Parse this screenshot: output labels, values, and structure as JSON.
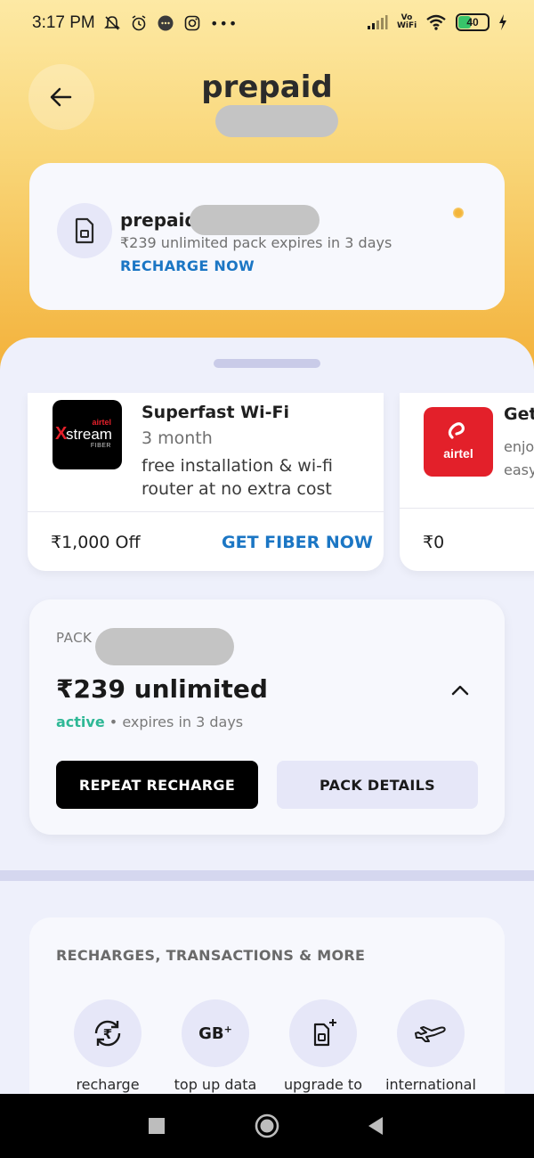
{
  "status_bar": {
    "time": "3:17 PM",
    "battery": "40",
    "vowifi": "Vo WiFi",
    "more": "•••"
  },
  "header": {
    "title": "prepaid"
  },
  "number_card": {
    "name": "prepaid",
    "subtitle": "₹239 unlimited pack expires in 3 days",
    "action": "RECHARGE NOW"
  },
  "offers": [
    {
      "logo_top": "airtel",
      "logo_main": "stream",
      "logo_bottom": "FIBER",
      "title": "Superfast Wi-Fi",
      "duration": "3 month",
      "description_line1": "free installation & wi-fi",
      "description_line2": "router at no extra cost",
      "price": "₹1,000 Off",
      "cta": "GET FIBER NOW"
    },
    {
      "logo_text": "airtel",
      "title": "Get",
      "description_line1": "enjo",
      "description_line2": "easy",
      "price": "₹0"
    }
  ],
  "pack": {
    "label": "PACK",
    "name": "₹239 unlimited",
    "status_active": "active",
    "status_rest": " • expires in 3 days",
    "repeat_label": "REPEAT RECHARGE",
    "details_label": "PACK DETAILS"
  },
  "more": {
    "title": "RECHARGES, TRANSACTIONS & MORE",
    "items": [
      {
        "label": "recharge",
        "icon": "recharge-icon"
      },
      {
        "label": "top up data",
        "icon": "gb-plus-icon",
        "icon_text": "GB"
      },
      {
        "label": "upgrade to",
        "icon": "sim-upgrade-icon"
      },
      {
        "label": "international",
        "icon": "plane-icon"
      }
    ]
  },
  "colors": {
    "accent_blue": "#1b76c4",
    "active_green": "#2fb896",
    "hero_top": "#fde9a4",
    "hero_bottom": "#f3b13a"
  }
}
